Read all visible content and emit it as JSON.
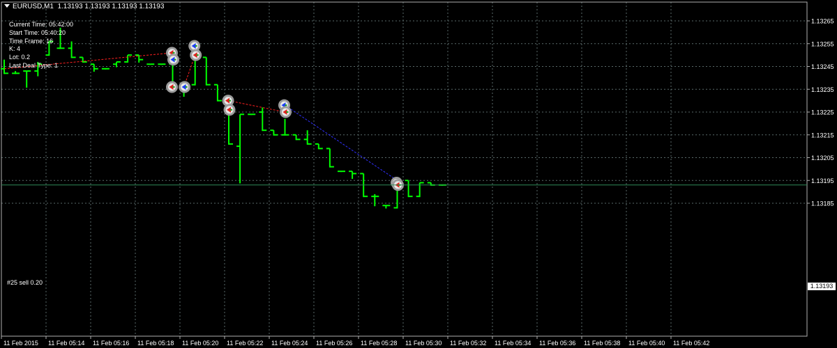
{
  "header": {
    "symbol_label": "EURUSD,M1",
    "ohlc_label": "1.13193 1.13193 1.13193 1.13193"
  },
  "info_lines": [
    "Current Time: 05:42:00",
    "Start Time: 05:40:20",
    "Time Frame: 16",
    "K: 4",
    "Lot: 0.2",
    "Last Deal Type: 1"
  ],
  "position_label": "#25 sell 0.20",
  "current_price_label": "1.13193",
  "colors": {
    "background": "#000000",
    "grid": "#5a6a6a",
    "bar": "#00ff00",
    "bid_line": "#2e8b57",
    "trade_line_red": "#ff2020",
    "trade_line_blue": "#3030ff",
    "marker_ring": "#9c9c9c"
  },
  "chart_data": {
    "type": "bar",
    "timeframe": "M1",
    "y_ticks": [
      "1.13265",
      "1.13255",
      "1.13245",
      "1.13235",
      "1.13225",
      "1.13215",
      "1.13205",
      "1.13195",
      "1.13185"
    ],
    "x_ticks": [
      "11 Feb 2015",
      "11 Feb 05:14",
      "11 Feb 05:16",
      "11 Feb 05:18",
      "11 Feb 05:20",
      "11 Feb 05:22",
      "11 Feb 05:24",
      "11 Feb 05:26",
      "11 Feb 05:28",
      "11 Feb 05:30",
      "11 Feb 05:32",
      "11 Feb 05:34",
      "11 Feb 05:36",
      "11 Feb 05:38",
      "11 Feb 05:40",
      "11 Feb 05:42"
    ],
    "bars": [
      {
        "o": 1.13244,
        "h": 1.13248,
        "l": 1.13242,
        "c": 1.13242
      },
      {
        "o": 1.13242,
        "h": 1.13243,
        "l": 1.13242,
        "c": 1.13242
      },
      {
        "o": 1.13243,
        "h": 1.13243,
        "l": 1.13236,
        "c": 1.13243
      },
      {
        "o": 1.13243,
        "h": 1.13247,
        "l": 1.13241,
        "c": 1.13246
      },
      {
        "o": 1.1325,
        "h": 1.13256,
        "l": 1.1325,
        "c": 1.13256
      },
      {
        "o": 1.13253,
        "h": 1.13262,
        "l": 1.13253,
        "c": 1.13253
      },
      {
        "o": 1.13253,
        "h": 1.13256,
        "l": 1.13249,
        "c": 1.13249
      },
      {
        "o": 1.13249,
        "h": 1.13249,
        "l": 1.13247,
        "c": 1.13247
      },
      {
        "o": 1.13246,
        "h": 1.13246,
        "l": 1.13243,
        "c": 1.13244
      },
      {
        "o": 1.13244,
        "h": 1.13244,
        "l": 1.13244,
        "c": 1.13244
      },
      {
        "o": 1.13246,
        "h": 1.13247,
        "l": 1.13245,
        "c": 1.13247
      },
      {
        "o": 1.13247,
        "h": 1.1325,
        "l": 1.13247,
        "c": 1.1325
      },
      {
        "o": 1.1325,
        "h": 1.1325,
        "l": 1.13247,
        "c": 1.13248
      },
      {
        "o": 1.13246,
        "h": 1.13246,
        "l": 1.13246,
        "c": 1.13246
      },
      {
        "o": 1.13246,
        "h": 1.13246,
        "l": 1.13246,
        "c": 1.13246
      },
      {
        "o": 1.13246,
        "h": 1.13245,
        "l": 1.13235,
        "c": 1.13235
      },
      {
        "o": 1.13235,
        "h": 1.13237,
        "l": 1.13232,
        "c": 1.13237
      },
      {
        "o": 1.13237,
        "h": 1.13252,
        "l": 1.13237,
        "c": 1.13249
      },
      {
        "o": 1.13249,
        "h": 1.13249,
        "l": 1.13237,
        "c": 1.13237
      },
      {
        "o": 1.13237,
        "h": 1.13237,
        "l": 1.1323,
        "c": 1.1323
      },
      {
        "o": 1.1323,
        "h": 1.13229,
        "l": 1.13211,
        "c": 1.13211
      },
      {
        "o": 1.1321,
        "h": 1.13209,
        "l": 1.13194,
        "c": 1.13224
      },
      {
        "o": 1.13224,
        "h": 1.13224,
        "l": 1.13224,
        "c": 1.13224
      },
      {
        "o": 1.13225,
        "h": 1.13227,
        "l": 1.13217,
        "c": 1.13217
      },
      {
        "o": 1.13217,
        "h": 1.13217,
        "l": 1.13215,
        "c": 1.13215
      },
      {
        "o": 1.13215,
        "h": 1.13222,
        "l": 1.13215,
        "c": 1.13215
      },
      {
        "o": 1.13215,
        "h": 1.13215,
        "l": 1.13213,
        "c": 1.13213
      },
      {
        "o": 1.13213,
        "h": 1.13217,
        "l": 1.13211,
        "c": 1.13211
      },
      {
        "o": 1.13211,
        "h": 1.13211,
        "l": 1.13209,
        "c": 1.13209
      },
      {
        "o": 1.13209,
        "h": 1.13209,
        "l": 1.13201,
        "c": 1.13201
      },
      {
        "o": 1.13199,
        "h": 1.13199,
        "l": 1.13199,
        "c": 1.13199
      },
      {
        "o": 1.13199,
        "h": 1.13199,
        "l": 1.13196,
        "c": 1.13198
      },
      {
        "o": 1.13198,
        "h": 1.13198,
        "l": 1.13188,
        "c": 1.13188
      },
      {
        "o": 1.13188,
        "h": 1.13189,
        "l": 1.13184,
        "c": 1.13188
      },
      {
        "o": 1.13184,
        "h": 1.13184,
        "l": 1.13183,
        "c": 1.13184
      },
      {
        "o": 1.13183,
        "h": 1.13195,
        "l": 1.13183,
        "c": 1.13195
      },
      {
        "o": 1.13195,
        "h": 1.13194,
        "l": 1.13188,
        "c": 1.13188
      },
      {
        "o": 1.13188,
        "h": 1.13194,
        "l": 1.13188,
        "c": 1.13194
      },
      {
        "o": 1.13194,
        "h": 1.13194,
        "l": 1.13194,
        "c": 1.13193
      },
      {
        "o": 1.13193,
        "h": 1.13193,
        "l": 1.13193,
        "c": 1.13193
      }
    ],
    "current_price": 1.13193,
    "trade_lines": [
      {
        "from_bar": 0,
        "from_price": 1.13244,
        "to_bar": 15,
        "to_price": 1.13251,
        "color": "red"
      },
      {
        "from_bar": 16,
        "from_price": 1.13236,
        "to_bar": 17,
        "to_price": 1.1325,
        "color": "red"
      },
      {
        "from_bar": 20,
        "from_price": 1.1323,
        "to_bar": 25,
        "to_price": 1.13225,
        "color": "red"
      },
      {
        "from_bar": 25,
        "from_price": 1.13228,
        "to_bar": 35,
        "to_price": 1.13195,
        "color": "blue"
      }
    ],
    "markers": [
      {
        "bar": 15,
        "price": 1.13251,
        "type": "sell"
      },
      {
        "bar": 15,
        "price": 1.13248,
        "type": "buy"
      },
      {
        "bar": 15,
        "price": 1.13236,
        "type": "sell"
      },
      {
        "bar": 16,
        "price": 1.13236,
        "type": "buy"
      },
      {
        "bar": 17,
        "price": 1.13254,
        "type": "buy"
      },
      {
        "bar": 17,
        "price": 1.1325,
        "type": "sell"
      },
      {
        "bar": 20,
        "price": 1.1323,
        "type": "sell"
      },
      {
        "bar": 20,
        "price": 1.13226,
        "type": "sell"
      },
      {
        "bar": 25,
        "price": 1.13228,
        "type": "buy"
      },
      {
        "bar": 25,
        "price": 1.13225,
        "type": "sell"
      },
      {
        "bar": 35,
        "price": 1.13194,
        "type": "buy"
      },
      {
        "bar": 35,
        "price": 1.13193,
        "type": "sell"
      }
    ]
  }
}
